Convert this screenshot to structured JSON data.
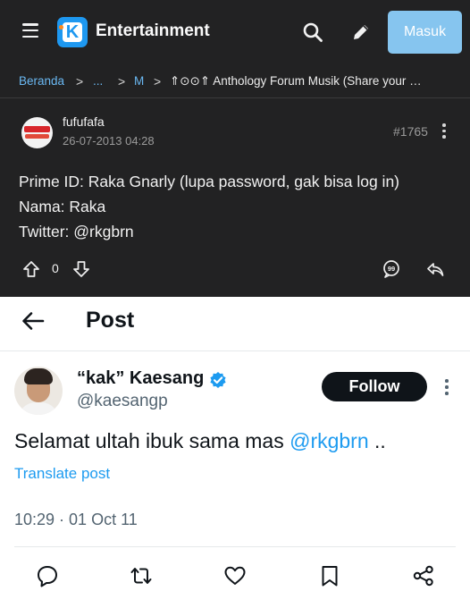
{
  "kaskus": {
    "title": "Entertainment",
    "logo_letter": "K",
    "login_label": "Masuk",
    "breadcrumb": {
      "home": "Beranda",
      "sep": ">",
      "ellipsis": "...",
      "m": "M",
      "last": "⇑⊙⊙⇑ Anthology Forum Musik (Share your Sou..."
    },
    "post": {
      "username": "fufufafa",
      "date": "26-07-2013 04:28",
      "number": "#1765",
      "lines": [
        "Prime ID: Raka Gnarly (lupa password, gak bisa log in)",
        "Nama: Raka",
        "Twitter: @rkgbrn"
      ],
      "vote_count": "0",
      "quote_badge": "99"
    },
    "colors": {
      "background": "#222223",
      "link": "#6ab8f2",
      "logo": "#1e98f0",
      "login_button": "#86c5ef"
    }
  },
  "twitter": {
    "header_title": "Post",
    "author": {
      "name": "“kak” Kaesang",
      "handle": "@kaesangp",
      "verified": true
    },
    "follow_label": "Follow",
    "tweet": {
      "text_before": "Selamat ultah ibuk sama mas ",
      "mention": "@rkgbrn",
      "text_after": " ..",
      "translate_label": "Translate post",
      "timestamp": "10:29 · 01 Oct 11"
    },
    "actions": [
      "reply-icon",
      "retweet-icon",
      "like-icon",
      "bookmark-icon",
      "share-icon"
    ],
    "colors": {
      "accent": "#1d9bf0",
      "text": "#0f1419",
      "muted": "#536471"
    }
  }
}
